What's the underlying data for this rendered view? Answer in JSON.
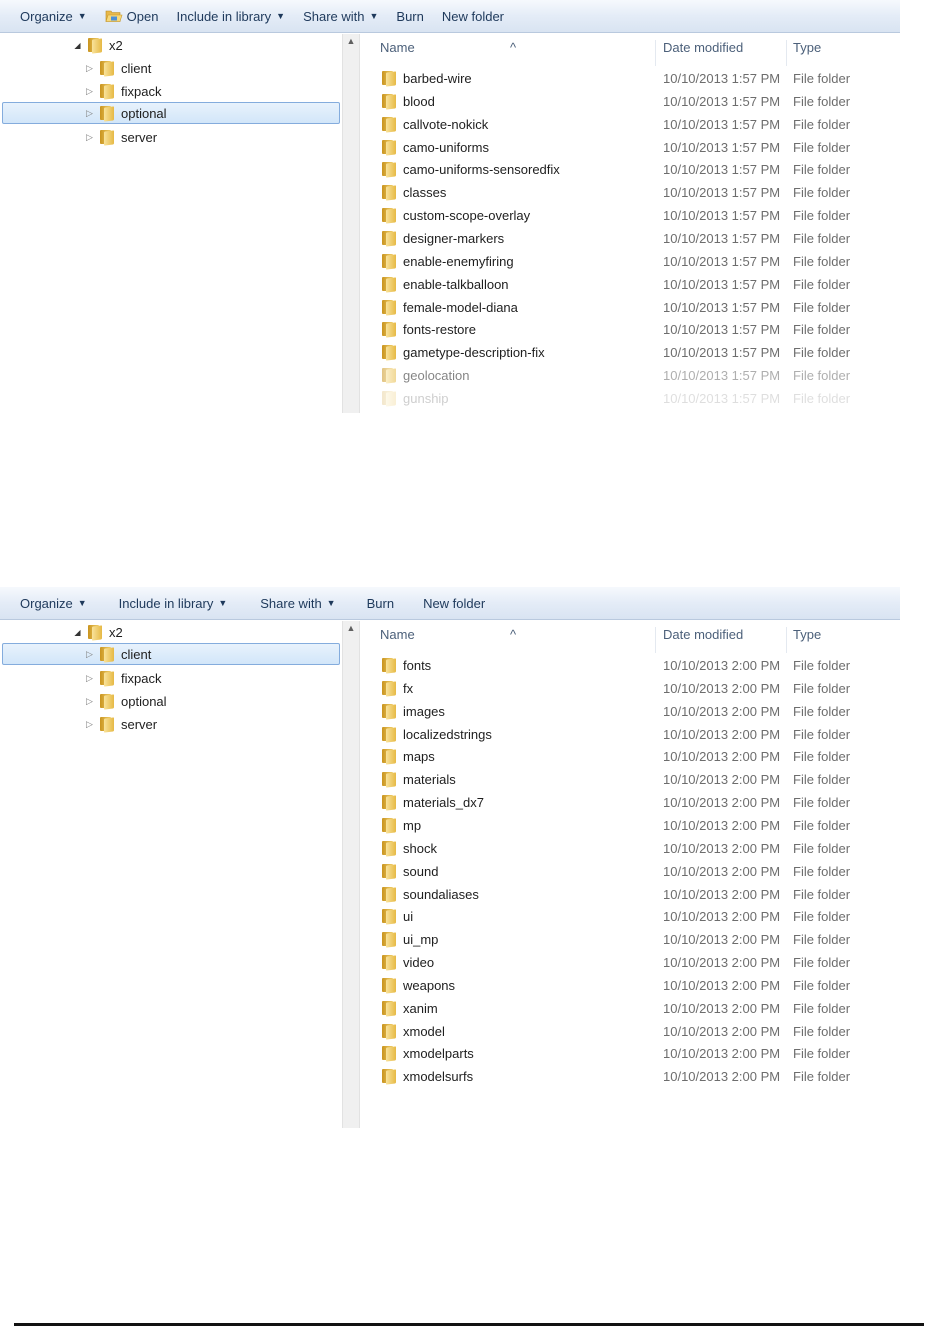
{
  "windows": [
    {
      "toolbar": [
        {
          "label": "Organize",
          "arrow": true
        },
        {
          "label": "Open",
          "icon": "open-folder-icon"
        },
        {
          "label": "Include in library",
          "arrow": true
        },
        {
          "label": "Share with",
          "arrow": true
        },
        {
          "label": "Burn"
        },
        {
          "label": "New folder"
        }
      ],
      "tree": {
        "root": "x2",
        "children": [
          "client",
          "fixpack",
          "optional",
          "server"
        ],
        "selected": "optional"
      },
      "columns": {
        "name": "Name",
        "date": "Date modified",
        "type": "Type"
      },
      "rows": [
        {
          "name": "barbed-wire",
          "date": "10/10/2013 1:57 PM",
          "type": "File folder"
        },
        {
          "name": "blood",
          "date": "10/10/2013 1:57 PM",
          "type": "File folder"
        },
        {
          "name": "callvote-nokick",
          "date": "10/10/2013 1:57 PM",
          "type": "File folder"
        },
        {
          "name": "camo-uniforms",
          "date": "10/10/2013 1:57 PM",
          "type": "File folder"
        },
        {
          "name": "camo-uniforms-sensoredfix",
          "date": "10/10/2013 1:57 PM",
          "type": "File folder"
        },
        {
          "name": "classes",
          "date": "10/10/2013 1:57 PM",
          "type": "File folder"
        },
        {
          "name": "custom-scope-overlay",
          "date": "10/10/2013 1:57 PM",
          "type": "File folder"
        },
        {
          "name": "designer-markers",
          "date": "10/10/2013 1:57 PM",
          "type": "File folder"
        },
        {
          "name": "enable-enemyfiring",
          "date": "10/10/2013 1:57 PM",
          "type": "File folder"
        },
        {
          "name": "enable-talkballoon",
          "date": "10/10/2013 1:57 PM",
          "type": "File folder"
        },
        {
          "name": "female-model-diana",
          "date": "10/10/2013 1:57 PM",
          "type": "File folder"
        },
        {
          "name": "fonts-restore",
          "date": "10/10/2013 1:57 PM",
          "type": "File folder"
        },
        {
          "name": "gametype-description-fix",
          "date": "10/10/2013 1:57 PM",
          "type": "File folder"
        },
        {
          "name": "geolocation",
          "date": "10/10/2013 1:57 PM",
          "type": "File folder"
        },
        {
          "name": "gunship",
          "date": "10/10/2013 1:57 PM",
          "type": "File folder"
        }
      ]
    },
    {
      "toolbar": [
        {
          "label": "Organize",
          "arrow": true
        },
        {
          "label": "Include in library",
          "arrow": true
        },
        {
          "label": "Share with",
          "arrow": true
        },
        {
          "label": "Burn"
        },
        {
          "label": "New folder"
        }
      ],
      "tree": {
        "root": "x2",
        "children": [
          "client",
          "fixpack",
          "optional",
          "server"
        ],
        "selected": "client"
      },
      "columns": {
        "name": "Name",
        "date": "Date modified",
        "type": "Type"
      },
      "rows": [
        {
          "name": "fonts",
          "date": "10/10/2013 2:00 PM",
          "type": "File folder"
        },
        {
          "name": "fx",
          "date": "10/10/2013 2:00 PM",
          "type": "File folder"
        },
        {
          "name": "images",
          "date": "10/10/2013 2:00 PM",
          "type": "File folder"
        },
        {
          "name": "localizedstrings",
          "date": "10/10/2013 2:00 PM",
          "type": "File folder"
        },
        {
          "name": "maps",
          "date": "10/10/2013 2:00 PM",
          "type": "File folder"
        },
        {
          "name": "materials",
          "date": "10/10/2013 2:00 PM",
          "type": "File folder"
        },
        {
          "name": "materials_dx7",
          "date": "10/10/2013 2:00 PM",
          "type": "File folder"
        },
        {
          "name": "mp",
          "date": "10/10/2013 2:00 PM",
          "type": "File folder"
        },
        {
          "name": "shock",
          "date": "10/10/2013 2:00 PM",
          "type": "File folder"
        },
        {
          "name": "sound",
          "date": "10/10/2013 2:00 PM",
          "type": "File folder"
        },
        {
          "name": "soundaliases",
          "date": "10/10/2013 2:00 PM",
          "type": "File folder"
        },
        {
          "name": "ui",
          "date": "10/10/2013 2:00 PM",
          "type": "File folder"
        },
        {
          "name": "ui_mp",
          "date": "10/10/2013 2:00 PM",
          "type": "File folder"
        },
        {
          "name": "video",
          "date": "10/10/2013 2:00 PM",
          "type": "File folder"
        },
        {
          "name": "weapons",
          "date": "10/10/2013 2:00 PM",
          "type": "File folder"
        },
        {
          "name": "xanim",
          "date": "10/10/2013 2:00 PM",
          "type": "File folder"
        },
        {
          "name": "xmodel",
          "date": "10/10/2013 2:00 PM",
          "type": "File folder"
        },
        {
          "name": "xmodelparts",
          "date": "10/10/2013 2:00 PM",
          "type": "File folder"
        },
        {
          "name": "xmodelsurfs",
          "date": "10/10/2013 2:00 PM",
          "type": "File folder"
        }
      ]
    }
  ]
}
